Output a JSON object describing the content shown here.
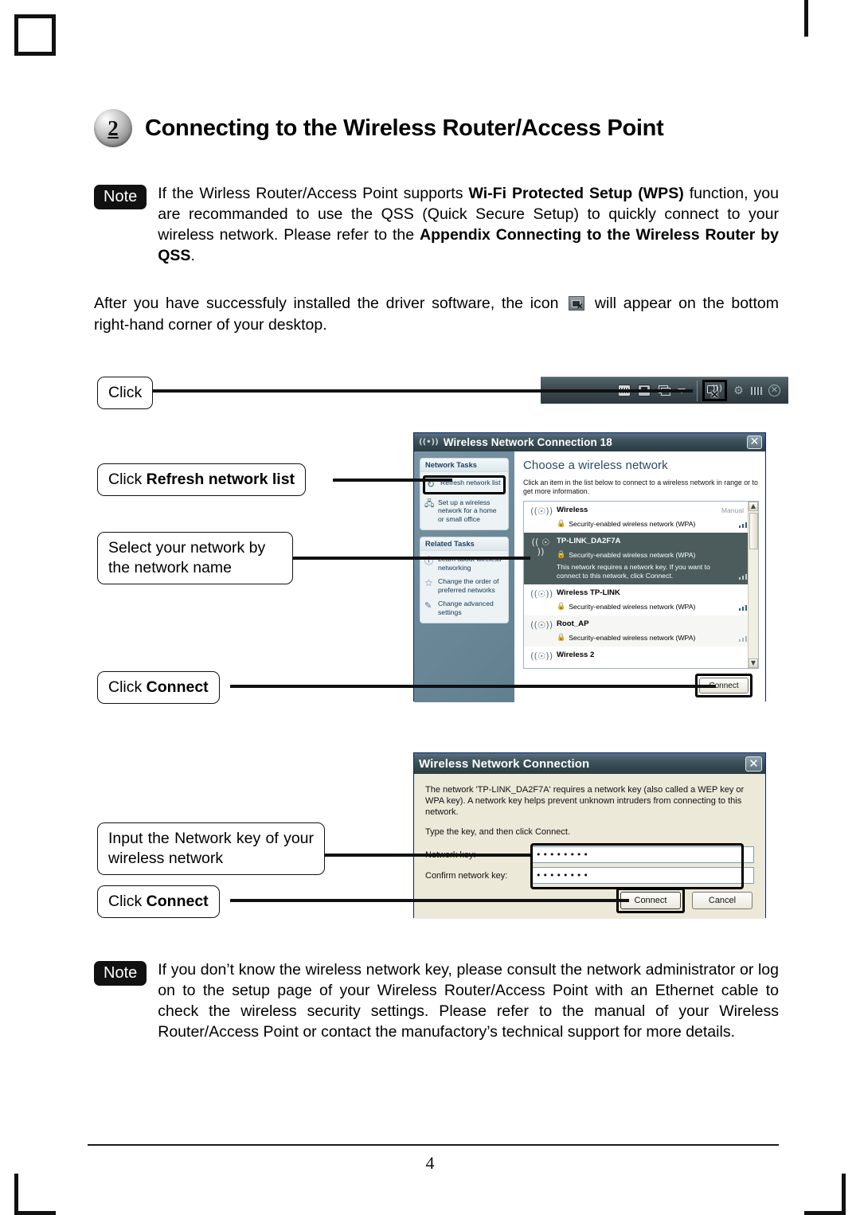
{
  "page": {
    "number": "4",
    "step_badge": "2",
    "heading": "Connecting to the Wireless Router/Access Point"
  },
  "note_top": {
    "badge": "Note",
    "part1": "If the Wirless Router/Access Point supports ",
    "bold1": "Wi-Fi Protected Setup (WPS)",
    "part2": " function, you are recommanded to use the QSS (Quick Secure Setup) to quickly connect to your wireless network. Please refer to the ",
    "bold2": "Appendix Connecting to the Wireless Router by QSS",
    "part3": "."
  },
  "body_paragraph": {
    "part1": "After you have successfuly installed the driver software, the icon ",
    "icon": "wireless-tray-icon",
    "part2": " will appear on the bottom right-hand corner of your desktop."
  },
  "callouts": {
    "click": "Click",
    "refresh_prefix": "Click ",
    "refresh_bold": "Refresh network list",
    "select": "Select your network by the network name",
    "connect1_prefix": "Click ",
    "connect1_bold": "Connect",
    "input_key": "Input the Network key of your wireless network",
    "connect2_prefix": "Click ",
    "connect2_bold": "Connect"
  },
  "taskbar": {
    "icons": [
      "keyboard-icon",
      "network-icon",
      "stacked-windows-icon",
      "show-hidden-arrow-icon"
    ],
    "tray_icons": [
      "wireless-connection-icon",
      "plug-icon",
      "chip-icon",
      "security-shield-icon"
    ],
    "highlighted": "wireless-connection-icon"
  },
  "dialog_choose": {
    "title": "Wireless Network Connection 18",
    "close_label": "✕",
    "heading": "Choose a wireless network",
    "instruction": "Click an item in the list below to connect to a wireless network in range or to get more information.",
    "sidebar": {
      "network_tasks_head": "Network Tasks",
      "network_tasks": [
        {
          "icon": "refresh-icon",
          "label": "Refresh network list",
          "highlighted": true
        },
        {
          "icon": "setup-wireless-icon",
          "label": "Set up a wireless network for a home or small office",
          "highlighted": false
        }
      ],
      "related_tasks_head": "Related Tasks",
      "related_tasks": [
        {
          "icon": "info-icon",
          "label": "Learn about wireless networking"
        },
        {
          "icon": "star-icon",
          "label": "Change the order of preferred networks"
        },
        {
          "icon": "advanced-settings-icon",
          "label": "Change advanced settings"
        }
      ]
    },
    "networks": [
      {
        "name": "Wireless",
        "security": "Security-enabled wireless network (WPA)",
        "badge": "Manual",
        "hint": "",
        "selected": false,
        "signal_bars": 5
      },
      {
        "name": "TP-LINK_DA2F7A",
        "security": "Security-enabled wireless network (WPA)",
        "badge": "",
        "hint": "This network requires a network key. If you want to connect to this network, click Connect.",
        "selected": true,
        "signal_bars": 5
      },
      {
        "name": "Wireless TP-LINK",
        "security": "Security-enabled wireless network (WPA)",
        "badge": "",
        "hint": "",
        "selected": false,
        "signal_bars": 5
      },
      {
        "name": "Root_AP",
        "security": "Security-enabled wireless network (WPA)",
        "badge": "",
        "hint": "",
        "selected": false,
        "signal_bars": 4
      },
      {
        "name": "Wireless  2",
        "security": "",
        "badge": "",
        "hint": "",
        "selected": false,
        "signal_bars": 3
      }
    ],
    "connect_button": "Connect"
  },
  "dialog_key": {
    "title": "Wireless Network Connection",
    "close_label": "✕",
    "paragraph": "The network 'TP-LINK_DA2F7A' requires a network key (also called a WEP key or WPA key). A network key helps prevent unknown intruders from connecting to this network.",
    "instruction": "Type the key, and then click Connect.",
    "network_key_label": "Network key:",
    "confirm_key_label": "Confirm network key:",
    "network_key_value": "••••••••",
    "confirm_key_value": "••••••••",
    "connect_button": "Connect",
    "cancel_button": "Cancel"
  },
  "note_bottom": {
    "badge": "Note",
    "text": "If you don’t know the wireless network key, please consult the network administrator or log on to the setup page of your Wireless Router/Access Point with an Ethernet cable to check the wireless security settings. Please refer to the manual of your Wireless Router/Access Point or contact the manufactory’s technical support for more details."
  }
}
